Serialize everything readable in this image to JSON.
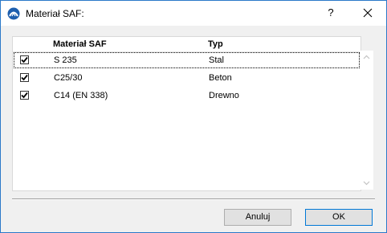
{
  "window": {
    "title": "Materiał SAF:",
    "help_label": "?"
  },
  "table": {
    "columns": [
      "Materiał SAF",
      "Typ"
    ],
    "rows": [
      {
        "checked": true,
        "material": "S 235",
        "type": "Stal",
        "selected": true
      },
      {
        "checked": true,
        "material": "C25/30",
        "type": "Beton",
        "selected": false
      },
      {
        "checked": true,
        "material": "C14 (EN 338)",
        "type": "Drewno",
        "selected": false
      }
    ]
  },
  "buttons": {
    "cancel_label": "Anuluj",
    "ok_label": "OK"
  },
  "colors": {
    "window_border": "#2b79c9",
    "default_button_border": "#0078d7"
  }
}
